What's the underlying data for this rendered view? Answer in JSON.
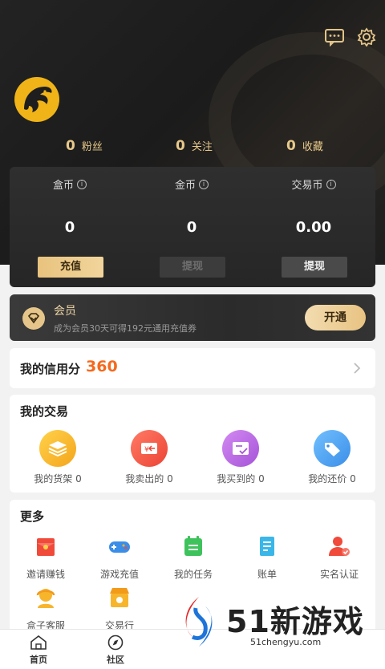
{
  "header": {
    "stats": [
      {
        "value": "0",
        "label": "粉丝"
      },
      {
        "value": "0",
        "label": "关注"
      },
      {
        "value": "0",
        "label": "收藏"
      }
    ]
  },
  "wallet": {
    "columns": [
      {
        "title": "盒币",
        "value": "0",
        "button": "充值"
      },
      {
        "title": "金币",
        "value": "0",
        "button": "提现"
      },
      {
        "title": "交易币",
        "value": "0.00",
        "button": "提现"
      }
    ],
    "info_glyph": "i"
  },
  "member": {
    "title": "会员",
    "subtitle": "成为会员30天可得192元通用充值券",
    "button": "开通"
  },
  "credit": {
    "label": "我的信用分",
    "score": "360"
  },
  "trade": {
    "title": "我的交易",
    "items": [
      {
        "label": "我的货架 0",
        "icon": "layers-icon",
        "color": "#f7b52c"
      },
      {
        "label": "我卖出的 0",
        "icon": "sell-icon",
        "color": "#f35a4a"
      },
      {
        "label": "我买到的 0",
        "icon": "bought-icon",
        "color": "#b86ae0"
      },
      {
        "label": "我的还价 0",
        "icon": "tag-icon",
        "color": "#4aa3f0"
      }
    ]
  },
  "more": {
    "title": "更多",
    "items": [
      {
        "label": "邀请赚钱",
        "icon": "red-envelope-icon"
      },
      {
        "label": "游戏充值",
        "icon": "gamepad-icon"
      },
      {
        "label": "我的任务",
        "icon": "task-calendar-icon"
      },
      {
        "label": "账单",
        "icon": "bill-icon"
      },
      {
        "label": "实名认证",
        "icon": "verify-user-icon"
      },
      {
        "label": "盒子客服",
        "icon": "support-icon"
      },
      {
        "label": "交易行",
        "icon": "shop-icon"
      }
    ]
  },
  "tabbar": {
    "items": [
      {
        "label": "首页",
        "icon": "home-icon"
      },
      {
        "label": "社区",
        "icon": "compass-icon"
      }
    ]
  },
  "watermark": {
    "text": "51新游戏",
    "url": "51chengyu.com"
  }
}
